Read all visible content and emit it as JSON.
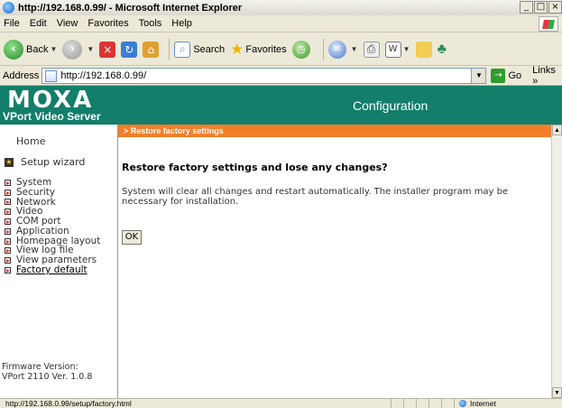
{
  "window": {
    "title": "http://192.168.0.99/ - Microsoft Internet Explorer",
    "buttons": {
      "minimize": "_",
      "maximize": "□",
      "close": "×"
    }
  },
  "menubar": [
    "File",
    "Edit",
    "View",
    "Favorites",
    "Tools",
    "Help"
  ],
  "toolbar": {
    "back": "Back",
    "search": "Search",
    "favorites": "Favorites"
  },
  "address": {
    "label": "Address",
    "url": "http://192.168.0.99/",
    "go": "Go",
    "links": "Links »"
  },
  "logo": {
    "brand": "MOXA",
    "product": "VPort Video Server"
  },
  "header": {
    "title": "Configuration"
  },
  "breadcrumb": "> Restore factory settings",
  "sidebar": {
    "home": "Home",
    "wizard": "Setup wizard",
    "items": [
      "System",
      "Security",
      "Network",
      "Video",
      "COM port",
      "Application",
      "Homepage layout",
      "View log file",
      "View parameters",
      "Factory default"
    ],
    "active_index": 9,
    "firmware_label": "Firmware Version:",
    "firmware_value": "VPort 2110 Ver. 1.0.8"
  },
  "main": {
    "heading": "Restore factory settings and lose any changes?",
    "description": "System will clear all changes and restart automatically. The installer program may be necessary for installation.",
    "ok": "OK"
  },
  "statusbar": {
    "url": "http://192.168.0.99/setup/factory.html",
    "zone": "Internet"
  }
}
